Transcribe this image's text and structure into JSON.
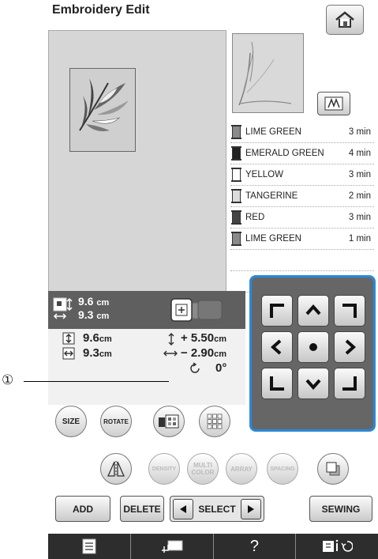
{
  "title": "Embroidery Edit",
  "home_icon": "home-icon",
  "thread_colors": [
    {
      "name": "LIME GREEN",
      "time": "3 min",
      "swatch": "#8a8a8a"
    },
    {
      "name": "EMERALD GREEN",
      "time": "4 min",
      "swatch": "#222222"
    },
    {
      "name": "YELLOW",
      "time": "3 min",
      "swatch": "#ffffff"
    },
    {
      "name": "TANGERINE",
      "time": "2 min",
      "swatch": "#dcdcdc"
    },
    {
      "name": "RED",
      "time": "3 min",
      "swatch": "#444444"
    },
    {
      "name": "LIME GREEN",
      "time": "1 min",
      "swatch": "#8a8a8a"
    }
  ],
  "size_panel": {
    "height": "9.6",
    "width": "9.3",
    "unit": "cm"
  },
  "info": {
    "height": "9.6",
    "width": "9.3",
    "unit": "cm",
    "vertical_offset": "+ 5.50",
    "horizontal_offset": "− 2.90",
    "rotation": "0°"
  },
  "callout": "①",
  "tool_buttons": {
    "size": "SIZE",
    "rotate": "ROTATE",
    "density": "DENSITY",
    "multi_color": "MULTI\nCOLOR",
    "array": "ARRAY",
    "spacing": "SPACING"
  },
  "bottom_buttons": {
    "add": "ADD",
    "delete": "DELETE",
    "select": "SELECT",
    "sewing": "SEWING"
  },
  "status_bar": {
    "help": "?"
  }
}
